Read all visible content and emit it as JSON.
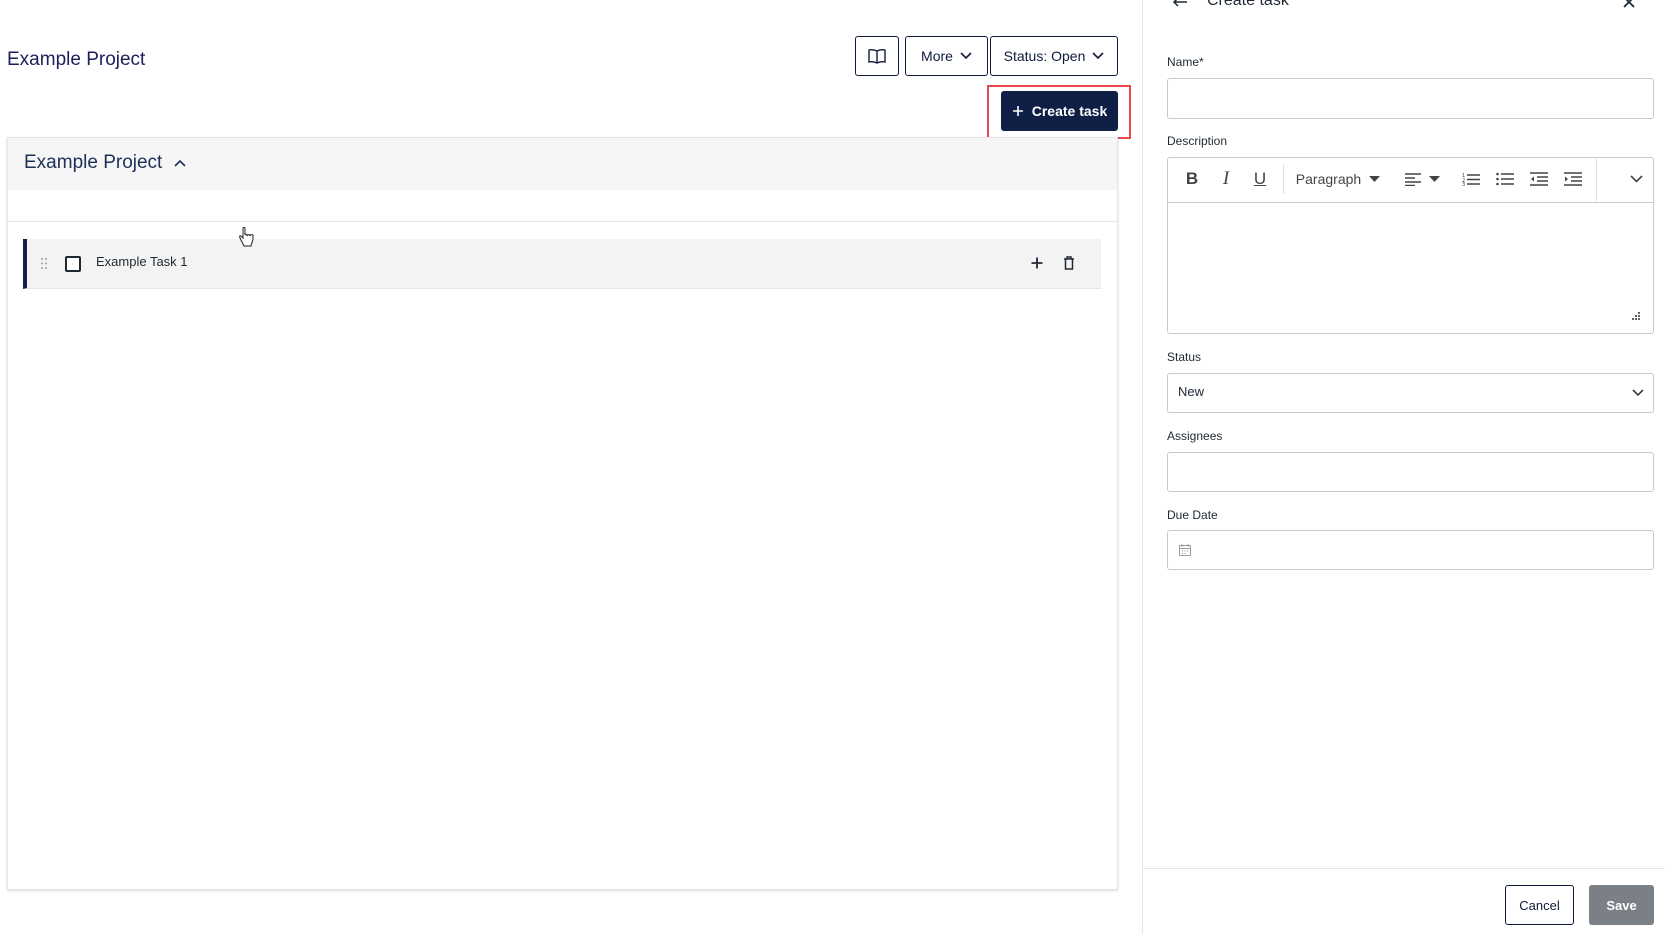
{
  "header": {
    "project_title": "Example Project",
    "more_label": "More",
    "status_label": "Status: Open",
    "create_task_label": "Create task"
  },
  "section": {
    "title": "Example Project"
  },
  "tasks": [
    {
      "label": "Example Task 1"
    }
  ],
  "side_panel": {
    "title": "Create task",
    "name_label": "Name*",
    "name_value": "",
    "description_label": "Description",
    "paragraph_label": "Paragraph",
    "status_label": "Status",
    "status_value": "New",
    "assignees_label": "Assignees",
    "due_date_label": "Due Date",
    "cancel_label": "Cancel",
    "save_label": "Save"
  },
  "colors": {
    "primary": "#0f1f45",
    "highlight": "#e5484d",
    "save_disabled": "#7b7f86"
  },
  "icons": [
    "book-icon",
    "chevron-down-icon",
    "plus-icon",
    "chevron-up-icon",
    "drag-handle-icon",
    "trash-icon",
    "back-arrow-icon",
    "close-icon",
    "calendar-icon",
    "bold-icon",
    "italic-icon",
    "underline-icon",
    "align-left-icon",
    "ordered-list-icon",
    "bullet-list-icon",
    "outdent-icon",
    "indent-icon",
    "resize-handle-icon",
    "cursor-hand-icon"
  ]
}
